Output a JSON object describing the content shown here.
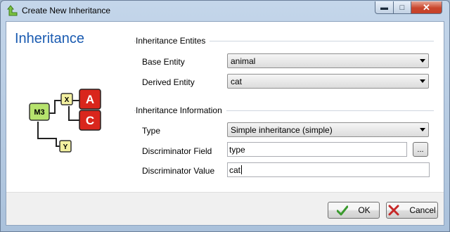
{
  "window": {
    "title": "Create New Inheritance"
  },
  "page": {
    "heading": "Inheritance"
  },
  "diagram": {
    "labels": [
      "M3",
      "X",
      "A",
      "C",
      "Y"
    ]
  },
  "entities_group": {
    "title": "Inheritance Entites",
    "base_label": "Base Entity",
    "base_value": "animal",
    "derived_label": "Derived Entity",
    "derived_value": "cat"
  },
  "info_group": {
    "title": "Inheritance Information",
    "type_label": "Type",
    "type_value": "Simple inheritance (simple)",
    "field_label": "Discriminator Field",
    "field_value": "type",
    "browse_label": "...",
    "value_label": "Discriminator Value",
    "value_value": "cat"
  },
  "buttons": {
    "ok": "OK",
    "cancel": "Cancel"
  },
  "colors": {
    "heading": "#1a5bb1",
    "ok_check": "#3a9a2e",
    "cancel_x": "#c62828",
    "badge_red": "#d9261c",
    "node_green": "#b6e36d",
    "node_yellow": "#f3f0a0"
  }
}
